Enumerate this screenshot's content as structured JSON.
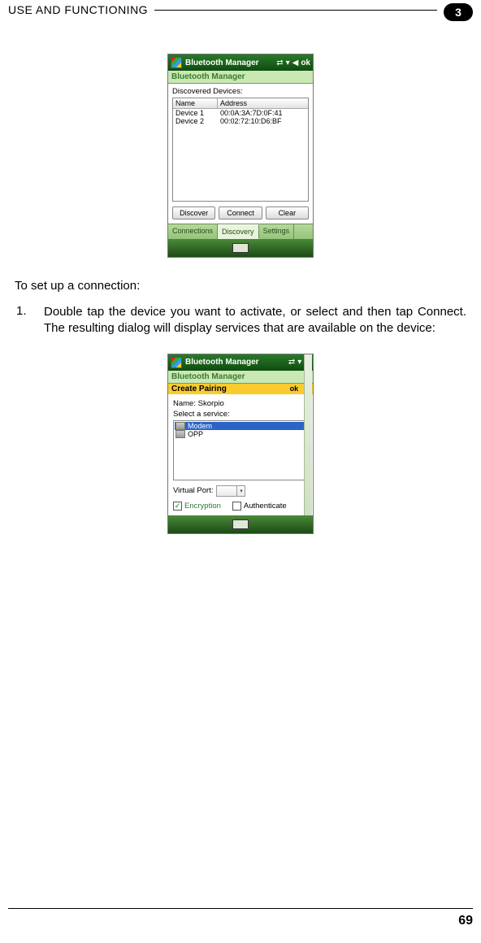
{
  "header": {
    "title": "USE AND FUNCTIONING",
    "chapter": "3"
  },
  "fig1": {
    "titlebar": "Bluetooth Manager",
    "titlebar_ok": "ok",
    "subbar": "Bluetooth Manager",
    "discovered_label": "Discovered Devices:",
    "col_name": "Name",
    "col_addr": "Address",
    "rows": [
      {
        "name": "Device 1",
        "addr": "00:0A:3A:7D:0F:41"
      },
      {
        "name": "Device 2",
        "addr": "00:02:72:10:D6:BF"
      }
    ],
    "btn_discover": "Discover",
    "btn_connect": "Connect",
    "btn_clear": "Clear",
    "tab_conn": "Connections",
    "tab_disc": "Discovery",
    "tab_set": "Settings"
  },
  "para_setup": "To set up a connection:",
  "step1": {
    "num": "1.",
    "text": "Double tap the device you want to activate, or select and then tap Connect. The resulting dialog will display services that are available on the device:"
  },
  "fig2": {
    "titlebar": "Bluetooth Manager",
    "subbar": "Bluetooth Manager",
    "yellow_title": "Create Pairing",
    "yellow_ok": "ok",
    "yellow_x": "×",
    "name_label": "Name:",
    "name_value": "Skorpio",
    "svc_label": "Select a service:",
    "svc_modem": "Modem",
    "svc_opp": "OPP",
    "vport_label": "Virtual Port:",
    "chk_enc": "Encryption",
    "chk_auth": "Authenticate"
  },
  "page_number": "69"
}
